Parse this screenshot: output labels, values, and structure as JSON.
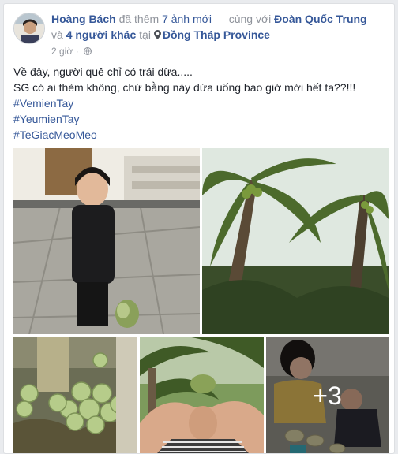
{
  "post": {
    "author": "Hoàng Bách",
    "action_text": "đã thêm",
    "photo_count_link": "7 ảnh mới",
    "with_text": "— cùng với",
    "tagged_user": "Đoàn Quốc Trung",
    "and_text": "và",
    "others_link": "4 người khác",
    "at_text": "tại",
    "location": "Đồng Tháp Province",
    "timestamp": "2 giờ",
    "separator": "·",
    "privacy_icon": "globe-icon",
    "lines": [
      "Về đây, người quê chỉ có trái dừa.....",
      "SG có ai thèm không, chứ bằng này dừa uống bao giờ mới hết ta??!!!"
    ],
    "hashtags": [
      "#VemienTay",
      "#YeumienTay",
      "#TeGiacMeoMeo"
    ]
  },
  "photos": {
    "more_count": "+3"
  },
  "colors": {
    "link": "#365899",
    "muted": "#90949c",
    "text": "#1d2129"
  }
}
